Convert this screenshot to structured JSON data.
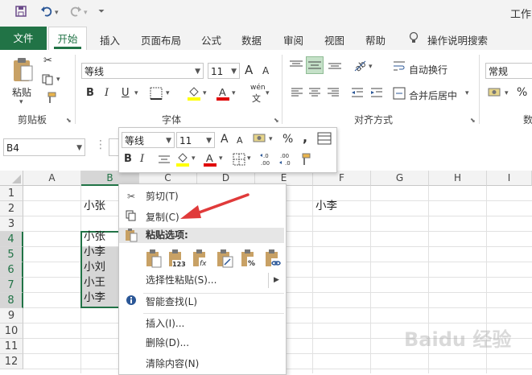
{
  "app": {
    "window_title_partial": "工作",
    "quick_access": [
      {
        "name": "save-icon"
      },
      {
        "name": "undo-icon"
      },
      {
        "name": "redo-icon"
      },
      {
        "name": "customize-qat-icon"
      }
    ]
  },
  "ribbon_tabs": [
    "文件",
    "开始",
    "插入",
    "页面布局",
    "公式",
    "数据",
    "审阅",
    "视图",
    "帮助",
    "操作说明搜索"
  ],
  "active_tab": "开始",
  "ribbon": {
    "clipboard": {
      "paste_label": "粘贴",
      "group_label": "剪贴板"
    },
    "font": {
      "font_name": "等线",
      "font_size": "11",
      "bold": "B",
      "italic": "I",
      "underline": "U",
      "grow": "A",
      "shrink": "A",
      "group_label": "字体",
      "wen": "wén"
    },
    "alignment": {
      "wrap_text": "自动换行",
      "merge_center": "合并后居中",
      "group_label": "对齐方式"
    },
    "number": {
      "format": "常规",
      "percent": "%",
      "group_label_partial": "数"
    }
  },
  "formula_bar": {
    "name_box": "B4"
  },
  "mini_toolbar": {
    "font_name": "等线",
    "font_size": "11",
    "grow": "A",
    "shrink": "A",
    "percent": "%",
    "comma": ",",
    "bold": "B",
    "italic": "I",
    "inc_decimal": "←.0\n.00",
    "dec_decimal": ".00\n→.0"
  },
  "columns": [
    "A",
    "B",
    "C",
    "D",
    "E",
    "F",
    "G",
    "H",
    "I"
  ],
  "rows": [
    "1",
    "2",
    "3",
    "4",
    "5",
    "6",
    "7",
    "8",
    "9",
    "10",
    "11",
    "12"
  ],
  "cells": {
    "B2": "小张",
    "F2": "小李",
    "B4": "小张",
    "B5": "小李",
    "B6": "小刘",
    "B7": "小王",
    "B8": "小李"
  },
  "context_menu": {
    "cut": "剪切(T)",
    "copy": "复制(C)",
    "paste_options": "粘贴选项:",
    "paste_special": "选择性粘贴(S)...",
    "smart_lookup": "智能查找(L)",
    "insert": "插入(I)...",
    "delete": "删除(D)...",
    "clear_contents": "清除内容(N)",
    "paste_icons": [
      "paste-icon",
      "paste-values-icon",
      "paste-formulas-icon",
      "paste-transpose-icon",
      "paste-formatting-icon",
      "paste-link-icon"
    ],
    "paste_icon_labels": [
      "",
      "123",
      "fx",
      "",
      "%",
      ""
    ]
  },
  "watermark": "Baidu 经验",
  "colors": {
    "excel_green": "#217346",
    "arrow_red": "#e03a3a",
    "selection_gray": "#d6d6d6"
  }
}
